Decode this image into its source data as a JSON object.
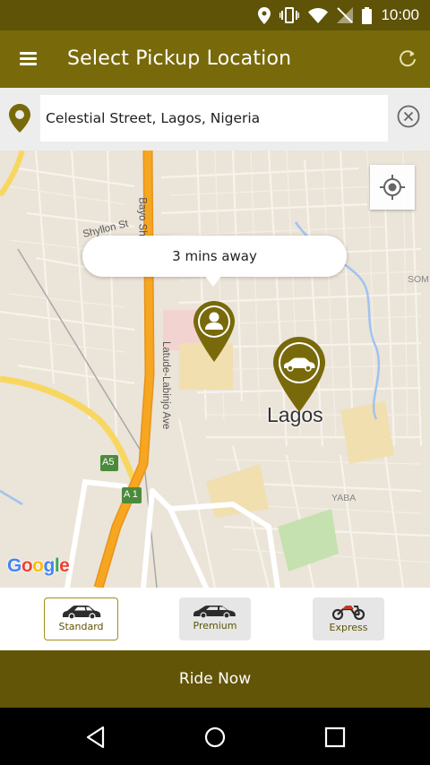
{
  "status_bar": {
    "time": "10:00",
    "icons": [
      "location-icon",
      "vibrate-icon",
      "wifi-icon",
      "no-signal-icon",
      "battery-icon"
    ]
  },
  "app_bar": {
    "title": "Select Pickup Location",
    "menu_icon": "hamburger-menu-icon",
    "refresh_icon": "refresh-icon"
  },
  "search": {
    "value": "Celestial Street, Lagos, Nigeria",
    "pin_icon": "location-pin-icon",
    "clear_icon": "clear-circle-icon"
  },
  "map": {
    "eta_text": "3 mins away",
    "city_label": "Lagos",
    "labels": {
      "shyllon": "Shyllon St",
      "bayo": "Bayo Sh",
      "latude": "Latude-Labinjo Ave",
      "yaba": "YABA",
      "som": "SOM",
      "a5": "A5",
      "a1": "A 1"
    },
    "google": {
      "G": "G",
      "o1": "o",
      "o2": "o",
      "g": "g",
      "l": "l",
      "e": "e"
    },
    "colors": {
      "marker": "#786a0a",
      "road_major": "#f6a620",
      "road_yellow": "#f8d760"
    }
  },
  "ride_options": [
    {
      "label": "Standard",
      "icon": "car-icon",
      "selected": true
    },
    {
      "label": "Premium",
      "icon": "car-icon",
      "selected": false
    },
    {
      "label": "Express",
      "icon": "motorbike-icon",
      "selected": false
    }
  ],
  "ride_now": {
    "label": "Ride Now"
  },
  "nav_bar": {
    "back": "back-icon",
    "home": "home-icon",
    "recents": "recents-icon"
  },
  "colors": {
    "status_bar": "#5e5306",
    "app_bar": "#786a0a",
    "ride_now_bar": "#625508",
    "accent": "#a08e1a"
  }
}
